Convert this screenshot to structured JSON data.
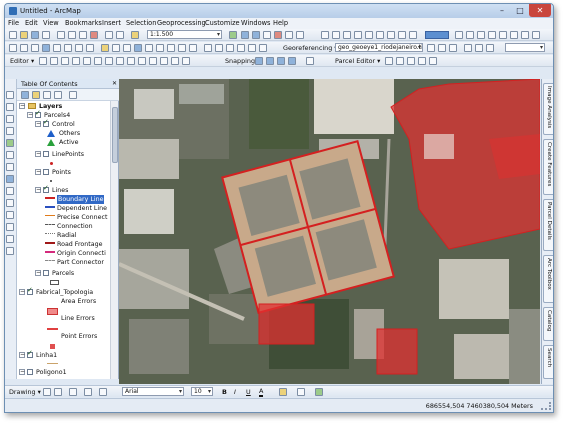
{
  "window": {
    "title": "Untitled - ArcMap"
  },
  "menu": [
    "File",
    "Edit",
    "View",
    "Bookmarks",
    "Insert",
    "Selection",
    "Geoprocessing",
    "Customize",
    "Windows",
    "Help"
  ],
  "toolbar1": {
    "scale": "1:1.500"
  },
  "toolbar2": {
    "georef_label": "Georeferencing ▾",
    "georef_layer": "geo_geoeye1_riodejaneiro.tif"
  },
  "toolbar3": {
    "editor_label": "Editor ▾",
    "snapping_label": "Snapping ▾",
    "parcel_editor_label": "Parcel Editor ▾"
  },
  "toc": {
    "title": "Table Of Contents",
    "items": [
      {
        "label": "Layers"
      },
      {
        "label": "Parcels4"
      },
      {
        "label": "Control"
      },
      {
        "label": "Others"
      },
      {
        "label": "Active"
      },
      {
        "label": "LinePoints"
      },
      {
        "label": "Points"
      },
      {
        "label": "Lines"
      },
      {
        "label": "Boundary Line"
      },
      {
        "label": "Dependent Line"
      },
      {
        "label": "Precise Connect"
      },
      {
        "label": "Connection"
      },
      {
        "label": "Radial"
      },
      {
        "label": "Road Frontage"
      },
      {
        "label": "Origin Connecti"
      },
      {
        "label": "Part Connector"
      },
      {
        "label": "Parcels"
      },
      {
        "label": "Fabrical_Topologia"
      },
      {
        "label": "Area Errors"
      },
      {
        "label": "Line Errors"
      },
      {
        "label": "Point Errors"
      },
      {
        "label": "Linha1"
      },
      {
        "label": "Poligono1"
      }
    ]
  },
  "right_tabs": [
    "Image Analysis",
    "Create Features",
    "Parcel Details",
    "Arc Toolbox",
    "Catalog",
    "Search"
  ],
  "drawing": {
    "label": "Drawing ▾",
    "font": "Arial",
    "size": "10",
    "bold": "B",
    "italic": "I",
    "underline": "U",
    "color_a": "A"
  },
  "status": {
    "coords": "686554,504  7460380,504 Meters"
  },
  "colors": {
    "parcel_outline": "#d42020",
    "highlight_fill": "#e03030"
  }
}
